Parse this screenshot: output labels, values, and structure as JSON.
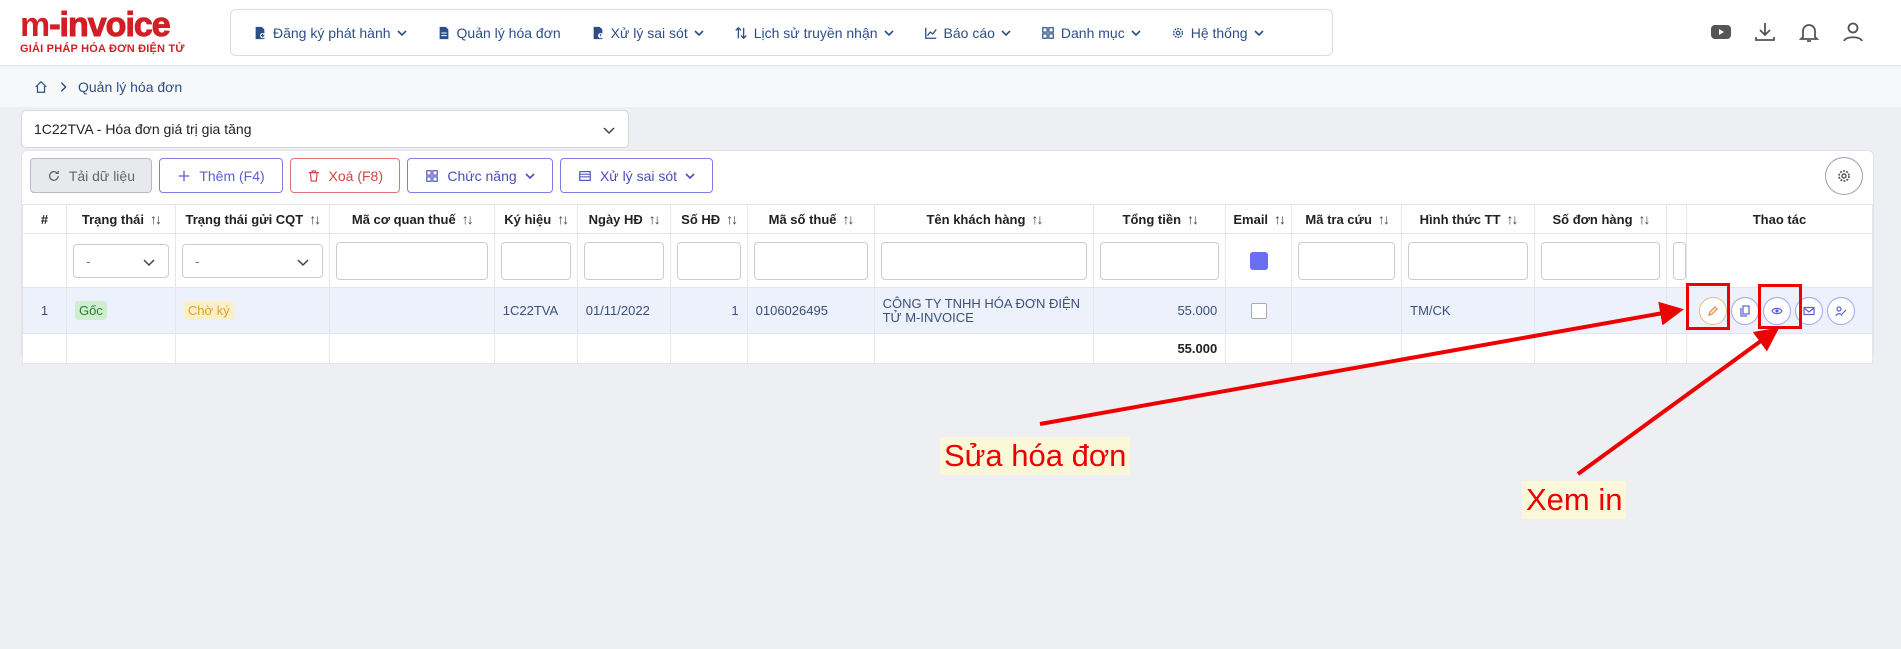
{
  "header": {
    "logo_main_left": "m",
    "logo_main_right": "-invoice",
    "logo_sub": "GIẢI PHÁP HÓA ĐƠN ĐIỆN TỬ",
    "nav": [
      {
        "label": "Đăng ký phát hành",
        "icon": "file-register-icon",
        "has_dropdown": true
      },
      {
        "label": "Quản lý hóa đơn",
        "icon": "file-icon",
        "has_dropdown": false
      },
      {
        "label": "Xử lý sai sót",
        "icon": "file-error-icon",
        "has_dropdown": true
      },
      {
        "label": "Lịch sử truyền nhận",
        "icon": "transfer-icon",
        "has_dropdown": true
      },
      {
        "label": "Báo cáo",
        "icon": "chart-icon",
        "has_dropdown": true
      },
      {
        "label": "Danh mục",
        "icon": "grid-icon",
        "has_dropdown": true
      },
      {
        "label": "Hệ thống",
        "icon": "gear-icon",
        "has_dropdown": true
      }
    ]
  },
  "breadcrumb": {
    "current": "Quản lý hóa đơn"
  },
  "series_select": {
    "value": "1C22TVA - Hóa đơn giá trị gia tăng"
  },
  "toolbar": {
    "reload_label": "Tải dữ liệu",
    "add_label": "Thêm (F4)",
    "delete_label": "Xoá (F8)",
    "function_label": "Chức năng",
    "fix_label": "Xử lý sai sót"
  },
  "table": {
    "columns": [
      "#",
      "Trạng thái",
      "Trạng thái gửi CQT",
      "Mã cơ quan thuế",
      "Ký hiệu",
      "Ngày HĐ",
      "Số HĐ",
      "Mã số thuế",
      "Tên khách hàng",
      "Tổng tiền",
      "Email",
      "Mã tra cứu",
      "Hình thức TT",
      "Số đơn hàng",
      "Thao tác"
    ],
    "filter_select_placeholder": "-",
    "rows": [
      {
        "index": "1",
        "status": "Gốc",
        "cqt_status": "Chờ ký",
        "tax_office_code": "",
        "symbol": "1C22TVA",
        "date": "01/11/2022",
        "number": "1",
        "tax_code": "0106026495",
        "customer": "CÔNG TY TNHH HÓA ĐƠN ĐIỆN TỬ M-INVOICE",
        "total": "55.000",
        "lookup_code": "",
        "payment": "TM/CK",
        "order_no": ""
      }
    ],
    "total_sum": "55.000"
  },
  "annotations": {
    "edit_note": "Sửa hóa đơn",
    "view_note": "Xem in"
  },
  "colors": {
    "brand_red": "#d11f26",
    "nav_blue": "#2d4f86",
    "accent_purple": "#5b5fd7",
    "annotation_red": "#ee0000"
  }
}
